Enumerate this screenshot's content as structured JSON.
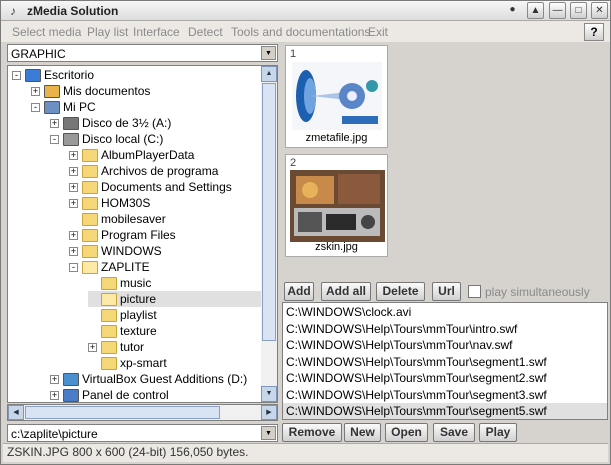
{
  "window": {
    "title": "zMedia Solution",
    "app_icon": "zmedia-logo-icon"
  },
  "titlebar_buttons": [
    "●",
    "▲",
    "—",
    "□",
    "✕"
  ],
  "menu": {
    "items": [
      "Select media",
      "Play list",
      "Interface",
      "Detect",
      "Tools and documentations",
      "Exit"
    ],
    "help": "?"
  },
  "media_type": {
    "selected": "GRAPHIC"
  },
  "tree": {
    "nodes": [
      {
        "label": "Escritorio",
        "icon": "desktop-icon",
        "expander": "-"
      },
      {
        "label": "Mis documentos",
        "icon": "my-documents-icon",
        "expander": "+"
      },
      {
        "label": "Mi PC",
        "icon": "my-computer-icon",
        "expander": "-"
      },
      {
        "label": "Disco de 3½ (A:)",
        "icon": "floppy-drive-icon",
        "expander": "+"
      },
      {
        "label": "Disco local (C:)",
        "icon": "hard-drive-icon",
        "expander": "-"
      },
      {
        "label": "AlbumPlayerData",
        "icon": "folder-icon",
        "expander": "+"
      },
      {
        "label": "Archivos de programa",
        "icon": "folder-icon",
        "expander": "+"
      },
      {
        "label": "Documents and Settings",
        "icon": "folder-icon",
        "expander": "+"
      },
      {
        "label": "HOM30S",
        "icon": "folder-icon",
        "expander": "+"
      },
      {
        "label": "mobilesaver",
        "icon": "folder-icon",
        "expander": ""
      },
      {
        "label": "Program Files",
        "icon": "folder-icon",
        "expander": "+"
      },
      {
        "label": "WINDOWS",
        "icon": "folder-icon",
        "expander": "+"
      },
      {
        "label": "ZAPLITE",
        "icon": "folder-open-icon",
        "expander": "-"
      },
      {
        "label": "music",
        "icon": "folder-icon",
        "expander": ""
      },
      {
        "label": "picture",
        "icon": "folder-open-icon",
        "expander": "",
        "selected": true
      },
      {
        "label": "playlist",
        "icon": "folder-icon",
        "expander": ""
      },
      {
        "label": "texture",
        "icon": "folder-icon",
        "expander": ""
      },
      {
        "label": "tutor",
        "icon": "folder-icon",
        "expander": "+"
      },
      {
        "label": "xp-smart",
        "icon": "folder-icon",
        "expander": ""
      },
      {
        "label": "VirtualBox Guest Additions (D:)",
        "icon": "cd-drive-icon",
        "expander": "+"
      },
      {
        "label": "Panel de control",
        "icon": "control-panel-icon",
        "expander": "+"
      }
    ]
  },
  "path": {
    "value": "c:\\zaplite\\picture"
  },
  "thumbnails": [
    {
      "num": "1",
      "caption": "zmetafile.jpg"
    },
    {
      "num": "2",
      "caption": "zskin.jpg"
    }
  ],
  "playlist_toolbar": {
    "add": "Add",
    "add_all": "Add all",
    "delete": "Delete",
    "url": "Url",
    "simultaneous": "play simultaneously"
  },
  "playlist": [
    "C:\\WINDOWS\\clock.avi",
    "C:\\WINDOWS\\Help\\Tours\\mmTour\\intro.swf",
    "C:\\WINDOWS\\Help\\Tours\\mmTour\\nav.swf",
    "C:\\WINDOWS\\Help\\Tours\\mmTour\\segment1.swf",
    "C:\\WINDOWS\\Help\\Tours\\mmTour\\segment2.swf",
    "C:\\WINDOWS\\Help\\Tours\\mmTour\\segment3.swf",
    "C:\\WINDOWS\\Help\\Tours\\mmTour\\segment5.swf"
  ],
  "playlist_actions": {
    "remove": "Remove",
    "new": "New",
    "open": "Open",
    "save": "Save",
    "play": "Play"
  },
  "status": "ZSKIN.JPG 800 x 600 (24-bit) 156,050 bytes."
}
